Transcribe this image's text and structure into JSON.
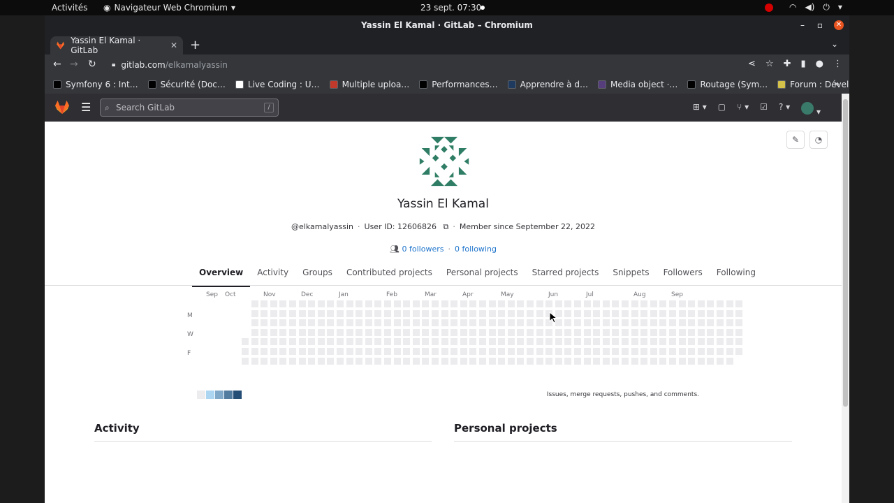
{
  "os": {
    "activities": "Activités",
    "app_name": "Navigateur Web Chromium",
    "clock": "23 sept.  07:30"
  },
  "window": {
    "title": "Yassin El Kamal · GitLab – Chromium"
  },
  "tab": {
    "title": "Yassin El Kamal · GitLab"
  },
  "address": {
    "host": "gitlab.com",
    "path": "/elkamalyassin"
  },
  "bookmarks": [
    {
      "label": "Symfony 6 : Int…",
      "color": "#000000"
    },
    {
      "label": "Sécurité (Doc…",
      "color": "#000000"
    },
    {
      "label": "Live Coding : U…",
      "color": "#ffffff"
    },
    {
      "label": "Multiple uploa…",
      "color": "#c0392b"
    },
    {
      "label": "Performances…",
      "color": "#000000"
    },
    {
      "label": "Apprendre à d…",
      "color": "#1e3a5f"
    },
    {
      "label": "Media object ·…",
      "color": "#563d7c"
    },
    {
      "label": "Routage (Sym…",
      "color": "#000000"
    },
    {
      "label": "Forum : Dével…",
      "color": "#d4c14a"
    }
  ],
  "gitlab_header": {
    "search_placeholder": "Search GitLab",
    "search_shortcut": "/"
  },
  "profile": {
    "name": "Yassin El Kamal",
    "handle": "@elkamalyassin",
    "user_id": "User ID: 12606826",
    "member_since": "Member since September 22, 2022",
    "followers": "0 followers",
    "following": "0 following"
  },
  "tabs": [
    "Overview",
    "Activity",
    "Groups",
    "Contributed projects",
    "Personal projects",
    "Starred projects",
    "Snippets",
    "Followers",
    "Following"
  ],
  "calendar": {
    "months": [
      "Sep",
      "Oct",
      "Nov",
      "Dec",
      "Jan",
      "Feb",
      "Mar",
      "Apr",
      "May",
      "Jun",
      "Jul",
      "Aug",
      "Sep"
    ],
    "days": [
      "M",
      "W",
      "F"
    ],
    "legend_colors": [
      "#ececef",
      "#acd5f2",
      "#7fa8c9",
      "#527ba0",
      "#254e77"
    ],
    "caption": "Issues, merge requests, pushes, and comments."
  },
  "sections": {
    "activity": "Activity",
    "personal_projects": "Personal projects"
  },
  "colors": {
    "accent_link": "#1f75cb",
    "gitlab_orange": "#fc6d26",
    "avatar_green": "#2e7d64"
  }
}
